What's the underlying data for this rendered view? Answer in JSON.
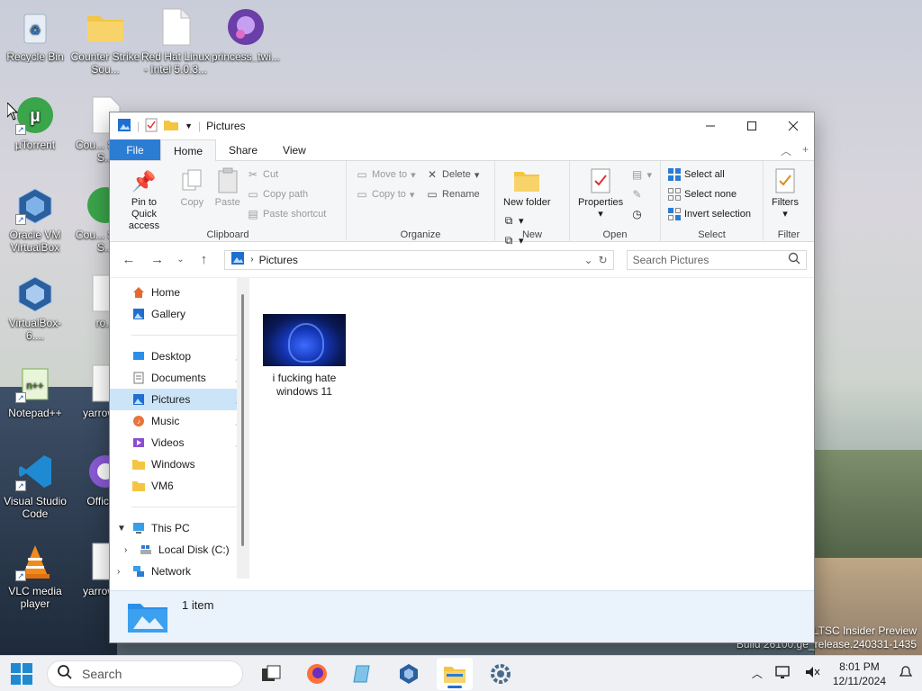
{
  "desktop": {
    "icons": [
      {
        "label": "Recycle Bin"
      },
      {
        "label": "Counter Strike Sou..."
      },
      {
        "label": "Red Hat Linux - Intel 5.0.3..."
      },
      {
        "label": "princess_twi..."
      },
      {
        "label": "µTorrent"
      },
      {
        "label": "Cou... Strike S..."
      },
      {
        "label": "Oracle VM VirtualBox"
      },
      {
        "label": "Cou... Strike S..."
      },
      {
        "label": "VirtualBox-6...."
      },
      {
        "label": "ro..."
      },
      {
        "label": "Notepad++"
      },
      {
        "label": "yarrow-..."
      },
      {
        "label": "Visual Studio Code"
      },
      {
        "label": "Office..."
      },
      {
        "label": "VLC media player"
      },
      {
        "label": "yarrow-..."
      }
    ],
    "watermark_line1": "e LTSC Insider Preview",
    "watermark_line2": "Build 26100.ge_release.240331-1435"
  },
  "window": {
    "title": "Pictures",
    "tabs": {
      "file": "File",
      "home": "Home",
      "share": "Share",
      "view": "View"
    },
    "ribbon": {
      "clipboard": {
        "label": "Clipboard",
        "pin": "Pin to Quick access",
        "copy": "Copy",
        "paste": "Paste",
        "cut": "Cut",
        "copy_path": "Copy path",
        "paste_shortcut": "Paste shortcut"
      },
      "organize": {
        "label": "Organize",
        "move_to": "Move to",
        "copy_to": "Copy to",
        "delete": "Delete",
        "rename": "Rename"
      },
      "new": {
        "label": "New",
        "new_folder": "New folder"
      },
      "open": {
        "label": "Open",
        "properties": "Properties"
      },
      "select": {
        "label": "Select",
        "select_all": "Select all",
        "select_none": "Select none",
        "invert": "Invert selection"
      },
      "filter": {
        "label": "Filter",
        "filters": "Filters"
      }
    },
    "address": {
      "path": "Pictures",
      "search_placeholder": "Search Pictures"
    },
    "nav": {
      "home": "Home",
      "gallery": "Gallery",
      "desktop": "Desktop",
      "documents": "Documents",
      "pictures": "Pictures",
      "music": "Music",
      "videos": "Videos",
      "windows": "Windows",
      "vm6": "VM6",
      "this_pc": "This PC",
      "local_disk": "Local Disk (C:)",
      "network": "Network"
    },
    "files": [
      {
        "name": "i fucking hate windows 11"
      }
    ],
    "status": {
      "count": "1 item"
    }
  },
  "taskbar": {
    "search_placeholder": "Search",
    "time": "8:01 PM",
    "date": "12/11/2024"
  },
  "colors": {
    "accent": "#2b7cd3",
    "selection": "#cce4f7",
    "folder": "#f4c542"
  }
}
